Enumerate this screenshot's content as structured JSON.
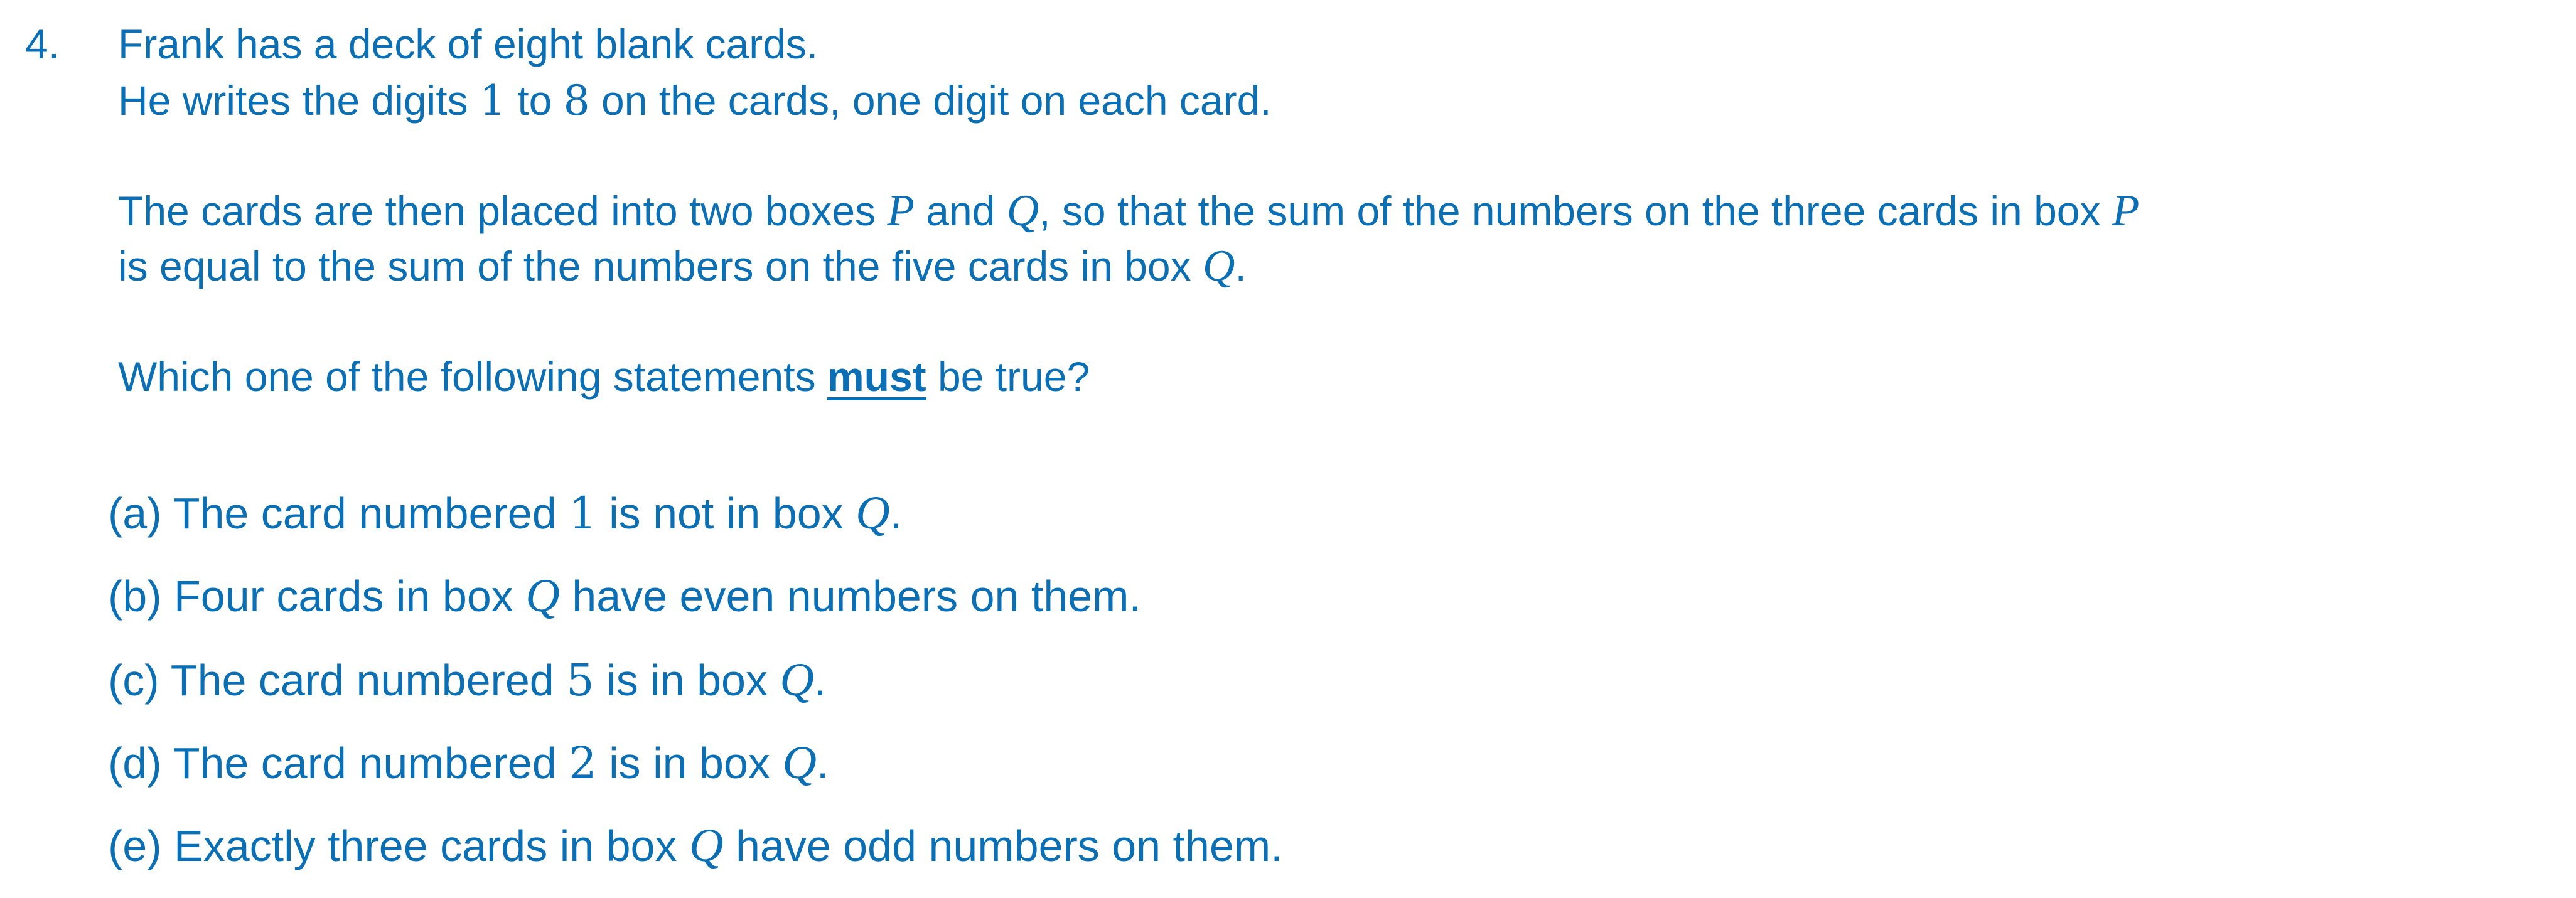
{
  "question": {
    "number": "4.",
    "line1": "Frank has a deck of eight blank cards.",
    "line2": {
      "a": "He writes the digits ",
      "n1": "1",
      "b": " to ",
      "n2": "8",
      "c": " on the cards, one digit on each card."
    },
    "line3": {
      "a": "The cards are then placed into two boxes ",
      "p": "P",
      "b": " and ",
      "q": "Q",
      "c": ", so that the sum of the numbers on the three cards in box ",
      "p2": "P"
    },
    "line4": {
      "a": "is equal to the sum of the numbers on the five cards in box ",
      "q": "Q",
      "b": "."
    },
    "line5": {
      "a": "Which one of the following statements ",
      "must": "must",
      "b": " be true?"
    }
  },
  "options": [
    {
      "a": "(a) The card numbered ",
      "m1": "1",
      "b": " is not in box ",
      "m2": "Q",
      "c": "."
    },
    {
      "a": "(b) Four cards in box ",
      "m1": "Q",
      "b": " have even numbers on them."
    },
    {
      "a": "(c) The card numbered ",
      "m1": "5",
      "b": " is in box ",
      "m2": "Q",
      "c": "."
    },
    {
      "a": "(d) The card numbered ",
      "m1": "2",
      "b": " is in box ",
      "m2": "Q",
      "c": "."
    },
    {
      "a": "(e) Exactly three cards in box ",
      "m1": "Q",
      "b": " have odd numbers on them."
    }
  ]
}
